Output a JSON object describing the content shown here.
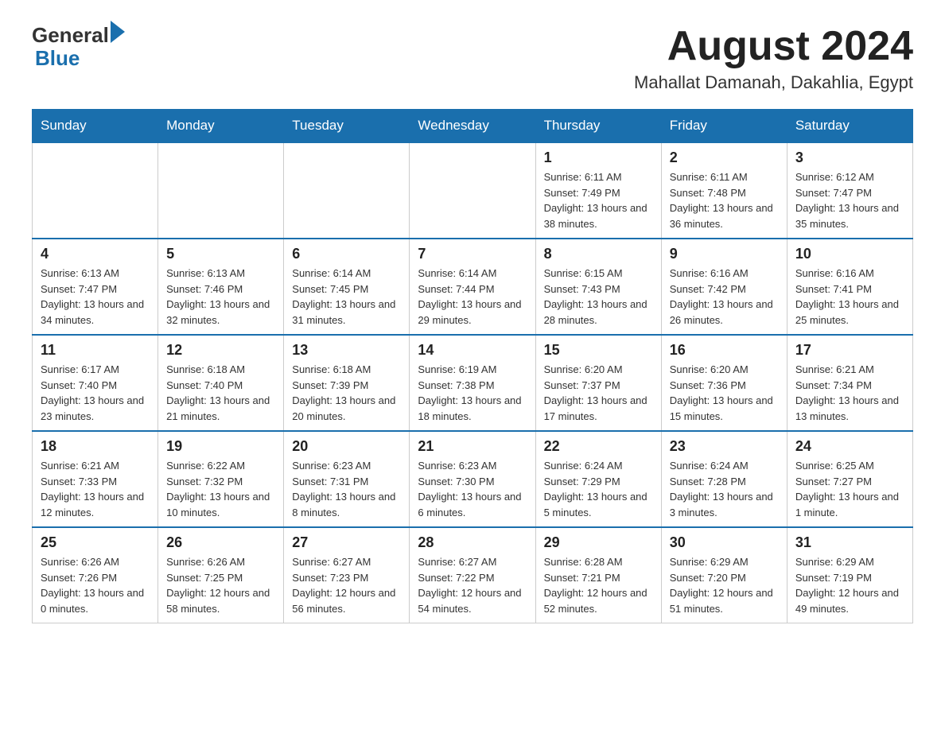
{
  "header": {
    "logo_general": "General",
    "logo_blue": "Blue",
    "month_title": "August 2024",
    "location": "Mahallat Damanah, Dakahlia, Egypt"
  },
  "days_of_week": [
    "Sunday",
    "Monday",
    "Tuesday",
    "Wednesday",
    "Thursday",
    "Friday",
    "Saturday"
  ],
  "weeks": [
    [
      {
        "day": "",
        "info": ""
      },
      {
        "day": "",
        "info": ""
      },
      {
        "day": "",
        "info": ""
      },
      {
        "day": "",
        "info": ""
      },
      {
        "day": "1",
        "info": "Sunrise: 6:11 AM\nSunset: 7:49 PM\nDaylight: 13 hours and 38 minutes."
      },
      {
        "day": "2",
        "info": "Sunrise: 6:11 AM\nSunset: 7:48 PM\nDaylight: 13 hours and 36 minutes."
      },
      {
        "day": "3",
        "info": "Sunrise: 6:12 AM\nSunset: 7:47 PM\nDaylight: 13 hours and 35 minutes."
      }
    ],
    [
      {
        "day": "4",
        "info": "Sunrise: 6:13 AM\nSunset: 7:47 PM\nDaylight: 13 hours and 34 minutes."
      },
      {
        "day": "5",
        "info": "Sunrise: 6:13 AM\nSunset: 7:46 PM\nDaylight: 13 hours and 32 minutes."
      },
      {
        "day": "6",
        "info": "Sunrise: 6:14 AM\nSunset: 7:45 PM\nDaylight: 13 hours and 31 minutes."
      },
      {
        "day": "7",
        "info": "Sunrise: 6:14 AM\nSunset: 7:44 PM\nDaylight: 13 hours and 29 minutes."
      },
      {
        "day": "8",
        "info": "Sunrise: 6:15 AM\nSunset: 7:43 PM\nDaylight: 13 hours and 28 minutes."
      },
      {
        "day": "9",
        "info": "Sunrise: 6:16 AM\nSunset: 7:42 PM\nDaylight: 13 hours and 26 minutes."
      },
      {
        "day": "10",
        "info": "Sunrise: 6:16 AM\nSunset: 7:41 PM\nDaylight: 13 hours and 25 minutes."
      }
    ],
    [
      {
        "day": "11",
        "info": "Sunrise: 6:17 AM\nSunset: 7:40 PM\nDaylight: 13 hours and 23 minutes."
      },
      {
        "day": "12",
        "info": "Sunrise: 6:18 AM\nSunset: 7:40 PM\nDaylight: 13 hours and 21 minutes."
      },
      {
        "day": "13",
        "info": "Sunrise: 6:18 AM\nSunset: 7:39 PM\nDaylight: 13 hours and 20 minutes."
      },
      {
        "day": "14",
        "info": "Sunrise: 6:19 AM\nSunset: 7:38 PM\nDaylight: 13 hours and 18 minutes."
      },
      {
        "day": "15",
        "info": "Sunrise: 6:20 AM\nSunset: 7:37 PM\nDaylight: 13 hours and 17 minutes."
      },
      {
        "day": "16",
        "info": "Sunrise: 6:20 AM\nSunset: 7:36 PM\nDaylight: 13 hours and 15 minutes."
      },
      {
        "day": "17",
        "info": "Sunrise: 6:21 AM\nSunset: 7:34 PM\nDaylight: 13 hours and 13 minutes."
      }
    ],
    [
      {
        "day": "18",
        "info": "Sunrise: 6:21 AM\nSunset: 7:33 PM\nDaylight: 13 hours and 12 minutes."
      },
      {
        "day": "19",
        "info": "Sunrise: 6:22 AM\nSunset: 7:32 PM\nDaylight: 13 hours and 10 minutes."
      },
      {
        "day": "20",
        "info": "Sunrise: 6:23 AM\nSunset: 7:31 PM\nDaylight: 13 hours and 8 minutes."
      },
      {
        "day": "21",
        "info": "Sunrise: 6:23 AM\nSunset: 7:30 PM\nDaylight: 13 hours and 6 minutes."
      },
      {
        "day": "22",
        "info": "Sunrise: 6:24 AM\nSunset: 7:29 PM\nDaylight: 13 hours and 5 minutes."
      },
      {
        "day": "23",
        "info": "Sunrise: 6:24 AM\nSunset: 7:28 PM\nDaylight: 13 hours and 3 minutes."
      },
      {
        "day": "24",
        "info": "Sunrise: 6:25 AM\nSunset: 7:27 PM\nDaylight: 13 hours and 1 minute."
      }
    ],
    [
      {
        "day": "25",
        "info": "Sunrise: 6:26 AM\nSunset: 7:26 PM\nDaylight: 13 hours and 0 minutes."
      },
      {
        "day": "26",
        "info": "Sunrise: 6:26 AM\nSunset: 7:25 PM\nDaylight: 12 hours and 58 minutes."
      },
      {
        "day": "27",
        "info": "Sunrise: 6:27 AM\nSunset: 7:23 PM\nDaylight: 12 hours and 56 minutes."
      },
      {
        "day": "28",
        "info": "Sunrise: 6:27 AM\nSunset: 7:22 PM\nDaylight: 12 hours and 54 minutes."
      },
      {
        "day": "29",
        "info": "Sunrise: 6:28 AM\nSunset: 7:21 PM\nDaylight: 12 hours and 52 minutes."
      },
      {
        "day": "30",
        "info": "Sunrise: 6:29 AM\nSunset: 7:20 PM\nDaylight: 12 hours and 51 minutes."
      },
      {
        "day": "31",
        "info": "Sunrise: 6:29 AM\nSunset: 7:19 PM\nDaylight: 12 hours and 49 minutes."
      }
    ]
  ]
}
